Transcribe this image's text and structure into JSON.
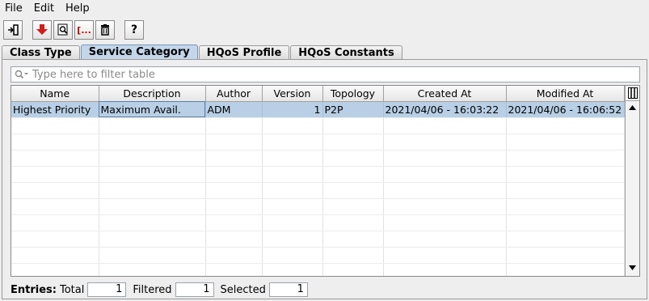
{
  "menu": [
    "File",
    "Edit",
    "Help"
  ],
  "toolbar": [
    "exit-icon",
    "download-red-icon",
    "inspect-icon",
    "bracket-icon",
    "delete-icon",
    "help-icon"
  ],
  "toolbar_help": "?",
  "toolbar_bracket": "[...",
  "tabs": [
    "Class Type",
    "Service Category",
    "HQoS Profile",
    "HQoS Constants"
  ],
  "filter_placeholder": "Type here to filter table",
  "columns": [
    "Name",
    "Description",
    "Author",
    "Version",
    "Topology",
    "Created At",
    "Modified At"
  ],
  "rows": [
    [
      "Highest Priority",
      "Maximum Avail.",
      "ADM",
      "1",
      "P2P",
      "2021/04/06 - 16:03:22",
      "2021/04/06 - 16:06:52"
    ]
  ],
  "footer": {
    "entries_label": "Entries:",
    "total_label": "Total",
    "total": "1",
    "filtered_label": "Filtered",
    "filtered": "1",
    "selected_label": "Selected",
    "selected": "1"
  },
  "colors": {
    "selection": "#b8cfe5",
    "active_tab": "#c3d6ea"
  }
}
